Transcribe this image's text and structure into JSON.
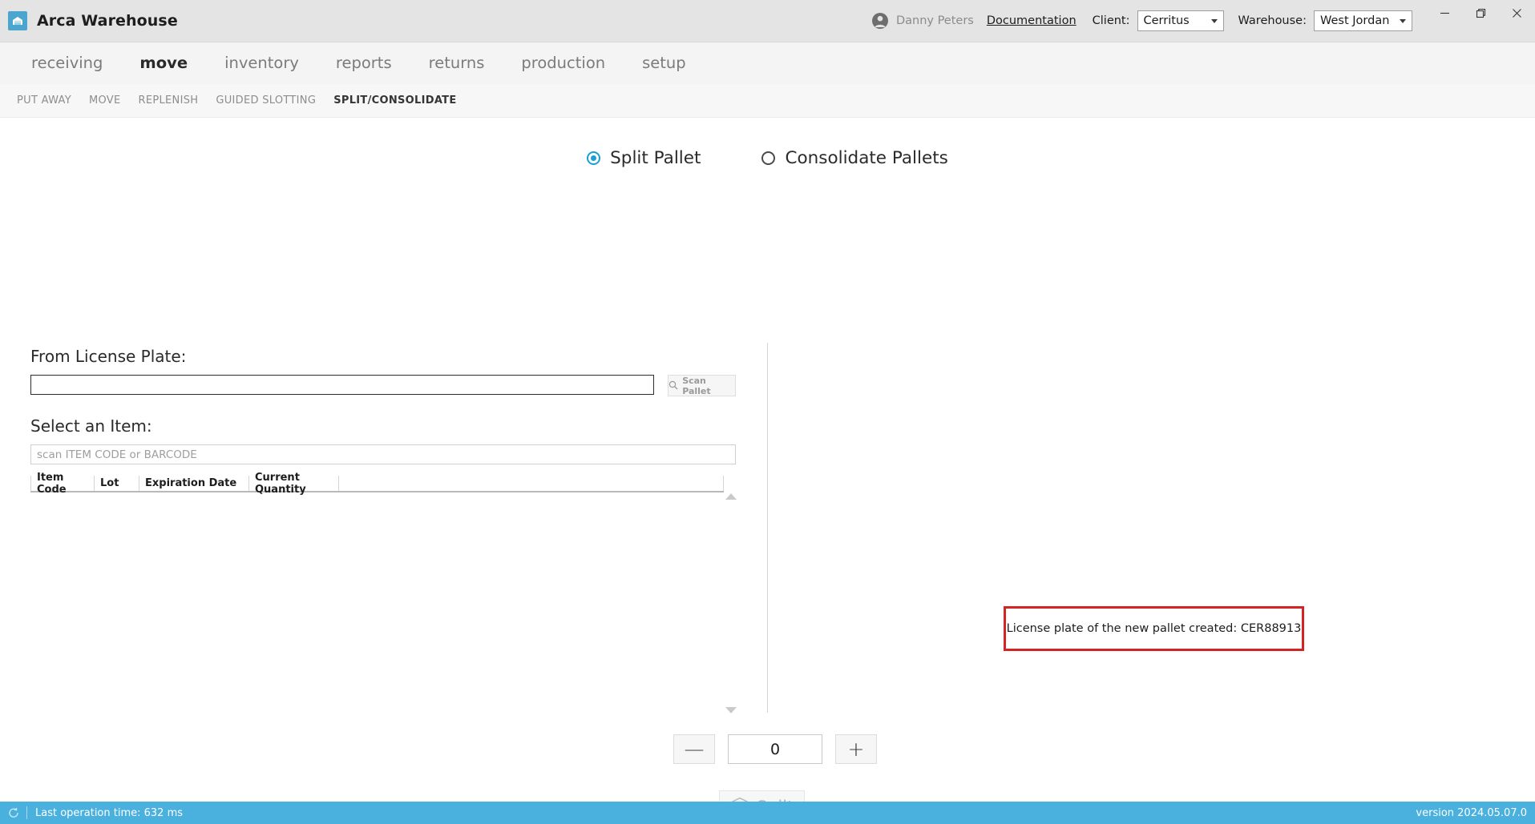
{
  "titlebar": {
    "app_title": "Arca Warehouse",
    "logo_icon": "warehouse-icon",
    "user_name": "Danny Peters",
    "avatar_icon": "avatar-icon",
    "documentation_link": "Documentation",
    "client_label": "Client:",
    "client_value": "Cerritus",
    "warehouse_label": "Warehouse:",
    "warehouse_value": "West Jordan",
    "minimize_icon": "minimize-icon",
    "maximize_icon": "maximize-icon",
    "close_icon": "close-icon"
  },
  "mainnav": {
    "items": [
      {
        "label": "receiving",
        "active": false
      },
      {
        "label": "move",
        "active": true
      },
      {
        "label": "inventory",
        "active": false
      },
      {
        "label": "reports",
        "active": false
      },
      {
        "label": "returns",
        "active": false
      },
      {
        "label": "production",
        "active": false
      },
      {
        "label": "setup",
        "active": false
      }
    ]
  },
  "subnav": {
    "items": [
      {
        "label": "PUT AWAY",
        "active": false
      },
      {
        "label": "MOVE",
        "active": false
      },
      {
        "label": "REPLENISH",
        "active": false
      },
      {
        "label": "GUIDED SLOTTING",
        "active": false
      },
      {
        "label": "SPLIT/CONSOLIDATE",
        "active": true
      }
    ]
  },
  "mode": {
    "split_label": "Split Pallet",
    "consolidate_label": "Consolidate Pallets",
    "selected": "Split Pallet"
  },
  "form": {
    "from_license_plate_label": "From License Plate:",
    "from_license_plate_value": "",
    "from_license_plate_placeholder": "",
    "scan_pallet_label": "Scan Pallet",
    "scan_icon": "search-icon",
    "select_item_label": "Select an Item:",
    "item_search_value": "",
    "item_search_placeholder": "scan ITEM CODE or BARCODE"
  },
  "grid": {
    "columns": [
      "Item Code",
      "Lot",
      "Expiration Date",
      "Current Quantity",
      ""
    ],
    "rows": []
  },
  "scroll": {
    "up_icon": "triangle-up-icon",
    "down_icon": "triangle-down-icon"
  },
  "alert": {
    "message": "License plate of the new pallet created: CER88913",
    "border_color": "#d42323"
  },
  "stepper": {
    "decrement_label": "—",
    "quantity_value": "0",
    "increment_label": "+"
  },
  "split_action": {
    "label": "Split",
    "icon": "box-3d-icon",
    "enabled": false
  },
  "statusbar": {
    "refresh_icon": "refresh-icon",
    "operation_text": "Last operation time:  632 ms",
    "version_text": "version 2024.05.07.0",
    "background_color": "#4ab0dd"
  }
}
